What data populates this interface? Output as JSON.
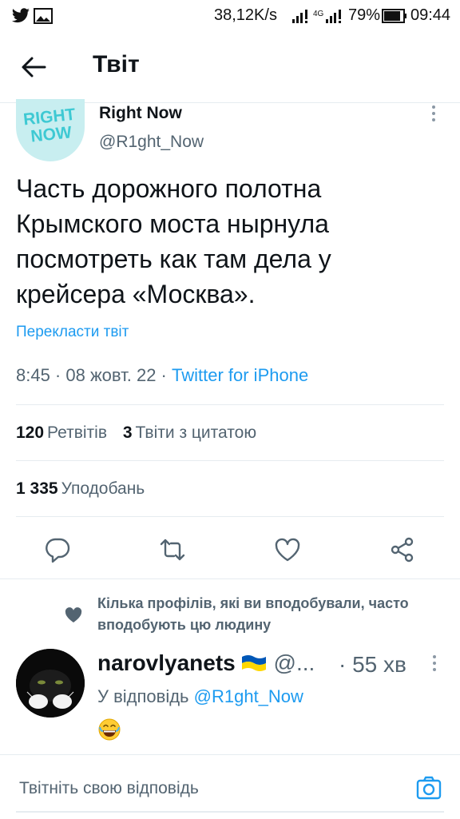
{
  "status_bar": {
    "speed": "38,12K/s",
    "network": "4G",
    "battery": "79%",
    "time": "09:44"
  },
  "header": {
    "title": "Твіт"
  },
  "tweet": {
    "author_name": "Right Now",
    "author_handle": "@R1ght_Now",
    "avatar_text_1": "RIGHT",
    "avatar_text_2": "NOW",
    "text": "Часть дорожного полотна Крымского моста нырнула посмотреть как там дела у крейсера «Москва».",
    "translate_label": "Перекласти твіт",
    "timestamp": "8:45 · 08 жовт. 22 · ",
    "source": "Twitter for iPhone",
    "retweets_count": "120",
    "retweets_label": "Ретвітів",
    "quotes_count": "3",
    "quotes_label": "Твіти з цитатою",
    "likes_count": "1 335",
    "likes_label": "Уподобань"
  },
  "social_context": {
    "text": "Кілька профілів, які ви вподобували, часто вподобують цю людину"
  },
  "reply": {
    "author_name": "narovlyanets",
    "author_handle": "@...",
    "time": "· 55 хв",
    "replying_prefix": "У відповідь ",
    "replying_to": "@R1ght_Now"
  },
  "compose": {
    "placeholder": "Твітніть свою відповідь"
  },
  "colors": {
    "accent": "#1d9bf0",
    "secondary_text": "#536471",
    "divider": "#e6ecf0",
    "avatar_bg": "#c8eef0",
    "avatar_text": "#3ec9d3"
  }
}
